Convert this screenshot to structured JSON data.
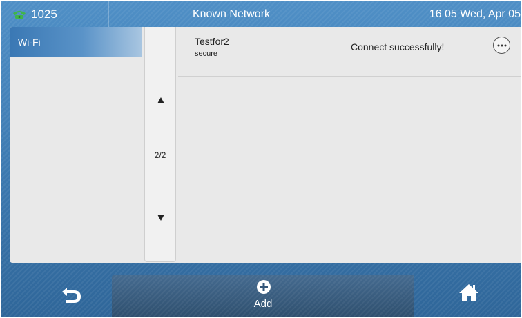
{
  "status_bar": {
    "line_label": "1025",
    "title": "Known Network",
    "datetime": "16 05 Wed, Apr 05"
  },
  "sidebar": {
    "items": [
      {
        "label": "Wi-Fi",
        "selected": true
      }
    ]
  },
  "pager": {
    "indicator": "2/2"
  },
  "networks": [
    {
      "name": "Testfor2",
      "security": "secure",
      "status": "Connect successfully!"
    }
  ],
  "softkeys": {
    "back_icon": "back-arrow-icon",
    "add_label": "Add",
    "add_icon": "plus-circle-icon",
    "home_icon": "home-icon"
  },
  "colors": {
    "bar_blue": "#3c79b0",
    "panel_gray": "#e9e9e9",
    "line_icon_green": "#3fb54a"
  }
}
